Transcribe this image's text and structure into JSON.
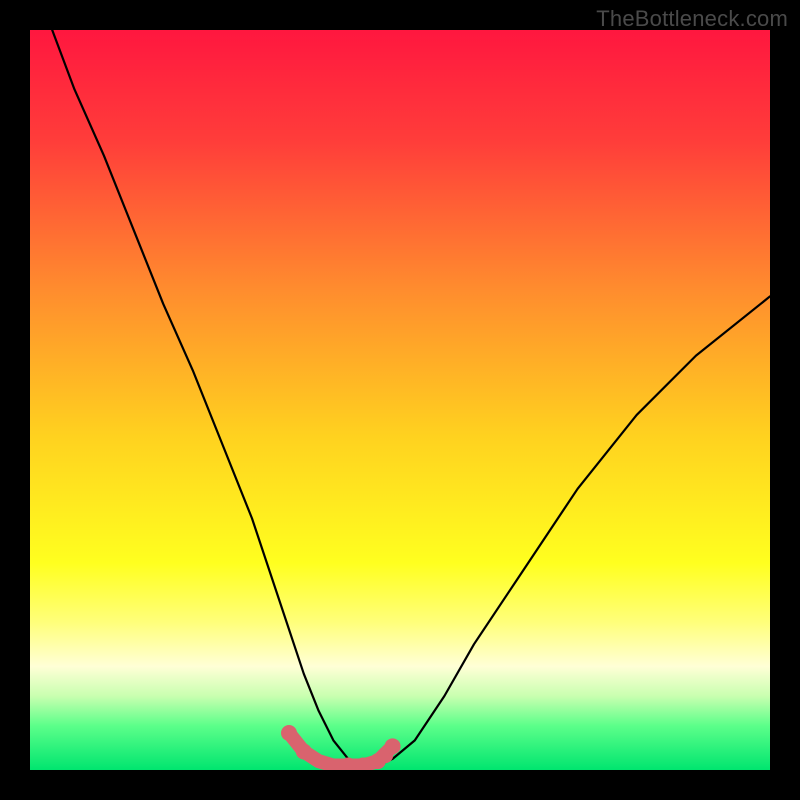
{
  "watermark": {
    "text": "TheBottleneck.com"
  },
  "chart_data": {
    "type": "line",
    "title": "",
    "xlabel": "",
    "ylabel": "",
    "xlim": [
      0,
      100
    ],
    "ylim": [
      0,
      100
    ],
    "background_gradient": {
      "stops": [
        {
          "offset": 0.0,
          "color": "#ff173f"
        },
        {
          "offset": 0.15,
          "color": "#ff3d3a"
        },
        {
          "offset": 0.35,
          "color": "#ff8c2e"
        },
        {
          "offset": 0.55,
          "color": "#ffd21f"
        },
        {
          "offset": 0.72,
          "color": "#ffff1f"
        },
        {
          "offset": 0.8,
          "color": "#ffff7a"
        },
        {
          "offset": 0.86,
          "color": "#ffffd6"
        },
        {
          "offset": 0.9,
          "color": "#c9ffb0"
        },
        {
          "offset": 0.94,
          "color": "#5cff8a"
        },
        {
          "offset": 1.0,
          "color": "#00e56f"
        }
      ]
    },
    "series": [
      {
        "name": "bottleneck-curve",
        "color": "#000000",
        "x": [
          3,
          6,
          10,
          14,
          18,
          22,
          26,
          30,
          33,
          35,
          37,
          39,
          41,
          43,
          45,
          47,
          49,
          52,
          56,
          60,
          66,
          74,
          82,
          90,
          100
        ],
        "y": [
          100,
          92,
          83,
          73,
          63,
          54,
          44,
          34,
          25,
          19,
          13,
          8,
          4,
          1.5,
          0.6,
          0.6,
          1.5,
          4,
          10,
          17,
          26,
          38,
          48,
          56,
          64
        ]
      }
    ],
    "highlight_segment": {
      "name": "optimal-range",
      "color": "#d9636e",
      "x": [
        35,
        37,
        39,
        41,
        43,
        45,
        47,
        49
      ],
      "y": [
        5,
        2.5,
        1.2,
        0.6,
        0.6,
        0.6,
        1.2,
        3.2
      ],
      "markers_x": [
        35,
        37,
        43,
        45,
        47,
        48,
        49
      ],
      "markers_y": [
        5,
        2.5,
        0.6,
        0.6,
        1.2,
        2.0,
        3.2
      ]
    }
  }
}
